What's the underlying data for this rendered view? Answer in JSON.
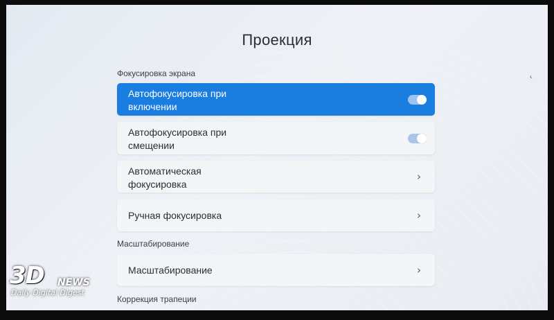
{
  "page": {
    "title": "Проекция"
  },
  "sections": {
    "focus": {
      "label": "Фокусировка экрана"
    },
    "scaling": {
      "label": "Масштабирование"
    },
    "keystone": {
      "label": "Коррекция трапеции"
    }
  },
  "items": [
    {
      "label": "Автофокусировка при включении",
      "control": "toggle",
      "state": "on",
      "selected": true
    },
    {
      "label": "Автофокусировка при смещении",
      "control": "toggle",
      "state": "on",
      "selected": false
    },
    {
      "label": "Автоматическая фокусировка",
      "control": "chevron",
      "selected": false
    },
    {
      "label": "Ручная фокусировка",
      "control": "chevron",
      "selected": false
    },
    {
      "label": "Масштабирование",
      "control": "chevron",
      "selected": false
    }
  ],
  "icons": {
    "toggle": "toggle-switch-icon",
    "chevron": "chevron-right-icon"
  },
  "colors": {
    "accent": "#1a7de0",
    "background": "#e8ecf2",
    "row": "#f4f5f7"
  },
  "watermark": {
    "main": "3D",
    "sub": "NEWS",
    "tagline": "Daily Digital Digest"
  }
}
